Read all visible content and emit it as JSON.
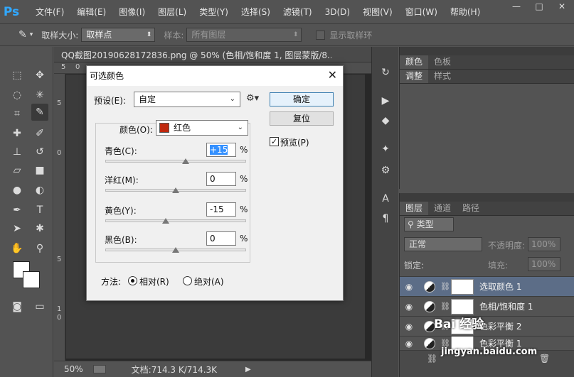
{
  "app": {
    "logo": "Ps"
  },
  "menu": [
    "文件(F)",
    "编辑(E)",
    "图像(I)",
    "图层(L)",
    "类型(Y)",
    "选择(S)",
    "滤镜(T)",
    "3D(D)",
    "视图(V)",
    "窗口(W)",
    "帮助(H)"
  ],
  "window_buttons": {
    "minimize": "—",
    "restore": "□",
    "close": "✕"
  },
  "options_bar": {
    "sample_size_label": "取样大小:",
    "sample_size_value": "取样点",
    "sample_label": "样本:",
    "sample_value": "所有图层",
    "show_ring_label": "显示取样环"
  },
  "document": {
    "tab_title": "QQ截图20190628172836.png @ 50% (色相/饱和度 1, 图层蒙版/8...",
    "ruler_top": [
      "5",
      "0"
    ],
    "ruler_left": [
      "5",
      "0",
      "5",
      "1",
      "0"
    ],
    "status_zoom": "50%",
    "status_doc": "文档:714.3 K/714.3K"
  },
  "right_panels": {
    "top_tabs": [
      "颜色",
      "色板"
    ],
    "mid_tabs": [
      "调整",
      "样式"
    ],
    "layers_tabs": [
      "图层",
      "通道",
      "路径"
    ],
    "filter_label": "类型",
    "blend_mode": "正常",
    "opacity_label": "不透明度:",
    "opacity_value": "100%",
    "lock_label": "锁定:",
    "fill_label": "填充:",
    "fill_value": "100%",
    "layers": [
      {
        "name": "选取颜色 1",
        "selected": true
      },
      {
        "name": "色相/饱和度 1",
        "selected": false
      },
      {
        "name": "色彩平衡 2",
        "selected": false
      },
      {
        "name": "色彩平衡 1",
        "selected": false
      }
    ]
  },
  "dialog": {
    "title": "可选颜色",
    "preset_label": "预设(E):",
    "preset_value": "自定",
    "ok_label": "确定",
    "reset_label": "复位",
    "preview_label": "预览(P)",
    "preview_checked": true,
    "colors_label": "颜色(O):",
    "colors_value": "红色",
    "colors_swatch": "#c0280e",
    "sliders": [
      {
        "label": "青色(C):",
        "value": "+15",
        "fraction": 0.57
      },
      {
        "label": "洋红(M):",
        "value": "0",
        "fraction": 0.5
      },
      {
        "label": "黄色(Y):",
        "value": "-15",
        "fraction": 0.43
      },
      {
        "label": "黑色(B):",
        "value": "0",
        "fraction": 0.5
      }
    ],
    "percent_sign": "%",
    "method_label": "方法:",
    "method_relative": "相对(R)",
    "method_absolute": "绝对(A)",
    "method_selected": "relative"
  },
  "watermark": {
    "line1": "Bai 经验",
    "line2": "jingyan.baidu.com"
  }
}
